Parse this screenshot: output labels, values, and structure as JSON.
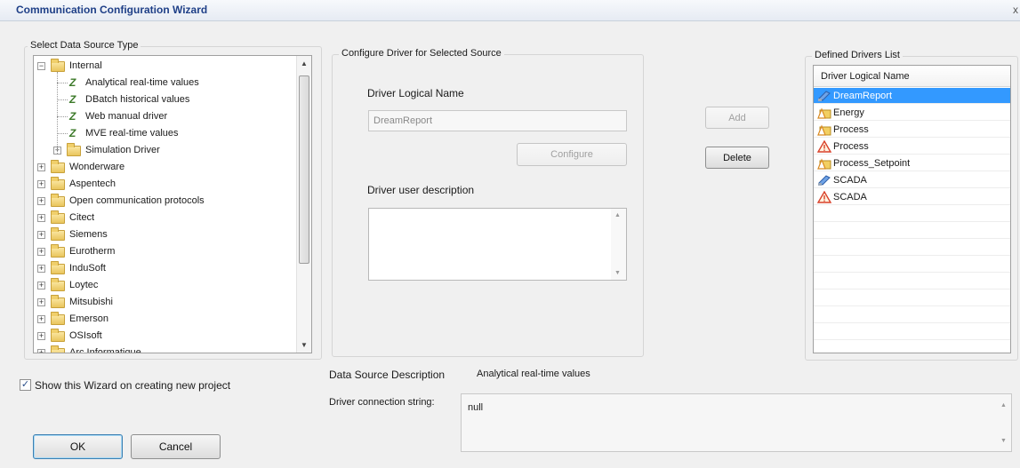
{
  "window": {
    "title": "Communication Configuration Wizard",
    "close": "x"
  },
  "data_source": {
    "group_label": "Select Data Source Type",
    "tree": [
      {
        "label": "Internal",
        "kind": "folder",
        "expander": "−",
        "indent": 0
      },
      {
        "label": "Analytical real-time values",
        "kind": "driver",
        "indent": 1
      },
      {
        "label": "DBatch historical values",
        "kind": "driver",
        "indent": 1
      },
      {
        "label": "Web manual driver",
        "kind": "driver",
        "indent": 1
      },
      {
        "label": "MVE real-time values",
        "kind": "driver",
        "indent": 1
      },
      {
        "label": "Simulation Driver",
        "kind": "folder",
        "expander": "+",
        "indent": 1
      },
      {
        "label": "Wonderware",
        "kind": "folder",
        "expander": "+",
        "indent": 0
      },
      {
        "label": "Aspentech",
        "kind": "folder",
        "expander": "+",
        "indent": 0
      },
      {
        "label": "Open communication protocols",
        "kind": "folder",
        "expander": "+",
        "indent": 0
      },
      {
        "label": "Citect",
        "kind": "folder",
        "expander": "+",
        "indent": 0
      },
      {
        "label": "Siemens",
        "kind": "folder",
        "expander": "+",
        "indent": 0
      },
      {
        "label": "Eurotherm",
        "kind": "folder",
        "expander": "+",
        "indent": 0
      },
      {
        "label": "InduSoft",
        "kind": "folder",
        "expander": "+",
        "indent": 0
      },
      {
        "label": "Loytec",
        "kind": "folder",
        "expander": "+",
        "indent": 0
      },
      {
        "label": "Mitsubishi",
        "kind": "folder",
        "expander": "+",
        "indent": 0
      },
      {
        "label": "Emerson",
        "kind": "folder",
        "expander": "+",
        "indent": 0
      },
      {
        "label": "OSIsoft",
        "kind": "folder",
        "expander": "+",
        "indent": 0
      },
      {
        "label": "Arc Informatique",
        "kind": "folder",
        "expander": "+",
        "indent": 0
      }
    ]
  },
  "configure": {
    "group_label": "Configure Driver for Selected Source",
    "logical_name_label": "Driver Logical Name",
    "logical_name_value": "DreamReport",
    "configure_button": "Configure",
    "description_label": "Driver user description",
    "description_value": ""
  },
  "actions": {
    "add_button": "Add",
    "delete_button": "Delete"
  },
  "drivers": {
    "group_label": "Defined Drivers List",
    "column_header": "Driver Logical Name",
    "rows": [
      {
        "name": "DreamReport",
        "icon": "plug-icon",
        "selected": true
      },
      {
        "name": "Energy",
        "icon": "folder-warning-icon",
        "selected": false
      },
      {
        "name": "Process",
        "icon": "folder-warning-icon",
        "selected": false
      },
      {
        "name": "Process",
        "icon": "warning-icon",
        "selected": false
      },
      {
        "name": "Process_Setpoint",
        "icon": "folder-warning-icon",
        "selected": false
      },
      {
        "name": "SCADA",
        "icon": "plug-icon",
        "selected": false
      },
      {
        "name": "SCADA",
        "icon": "warning-icon",
        "selected": false
      }
    ]
  },
  "info": {
    "data_source_description_label": "Data Source Description",
    "data_source_description_value": "Analytical real-time values",
    "connection_string_label": "Driver connection string:",
    "connection_string_value": "null"
  },
  "footer": {
    "show_wizard_label": "Show this Wizard on creating new project",
    "show_wizard_checked": "✓",
    "ok_button": "OK",
    "cancel_button": "Cancel"
  },
  "colors": {
    "title": "#1e3f87",
    "selection": "#3399ff"
  }
}
